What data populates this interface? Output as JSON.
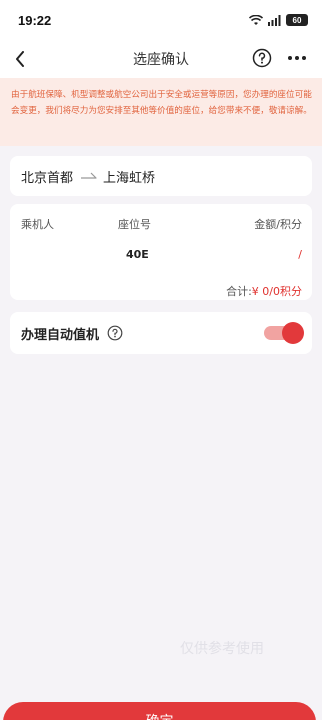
{
  "status_bar": {
    "time": "19:22",
    "battery": "60"
  },
  "nav": {
    "title": "选座确认"
  },
  "notice": {
    "text": "由于航班保障、机型调整或航空公司出于安全或运营等原因，您办理的座位可能会变更，我们将尽力为您安排至其他等价值的座位，给您带来不便，敬请谅解。"
  },
  "route": {
    "from": "北京首都",
    "to": "上海虹桥"
  },
  "passenger": {
    "headers": {
      "passenger": "乘机人",
      "seat": "座位号",
      "amount": "金额/积分"
    },
    "seat": "40E",
    "amount": "/",
    "total_label": "合计:",
    "total_value": "¥ 0/0积分"
  },
  "checkin": {
    "label": "办理自动值机",
    "enabled": true
  },
  "watermark": "仅供参考使用",
  "footer": {
    "confirm_label": "确定"
  },
  "colors": {
    "accent": "#e2393b",
    "notice_bg": "#fcebe6",
    "notice_text": "#e1643f"
  }
}
